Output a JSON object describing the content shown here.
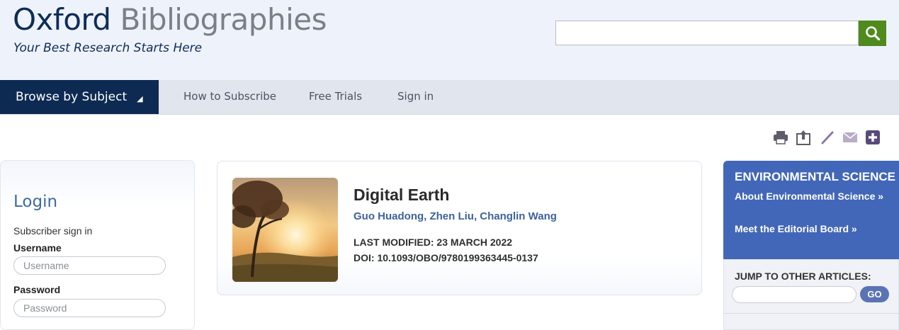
{
  "brand": {
    "name_primary": "Oxford",
    "name_secondary": "Bibliographies",
    "tagline": "Your Best Research Starts Here"
  },
  "search": {
    "value": "",
    "button_icon": "search-icon",
    "button_color": "#4f8a1d"
  },
  "nav": {
    "browse_label": "Browse by Subject",
    "browse_icon": "triangle-up-icon",
    "links": [
      "How to Subscribe",
      "Free Trials",
      "Sign in"
    ]
  },
  "toolbar": {
    "icons": [
      "print-icon",
      "share-icon",
      "edit-icon",
      "email-icon",
      "add-icon"
    ]
  },
  "login": {
    "title": "Login",
    "subtitle": "Subscriber sign in",
    "username_label": "Username",
    "username_placeholder": "Username",
    "password_label": "Password",
    "password_placeholder": "Password"
  },
  "article": {
    "title": "Digital Earth",
    "authors": "Guo Huadong, Zhen Liu, Changlin Wang",
    "last_modified": "LAST MODIFIED: 23 MARCH 2022",
    "doi": "DOI: 10.1093/OBO/9780199363445-0137"
  },
  "subject_panel": {
    "title": "ENVIRONMENTAL SCIENCE",
    "about_link": "About Environmental Science »",
    "board_link": "Meet the Editorial Board »",
    "color": "#4267b8"
  },
  "jump": {
    "title": "JUMP TO OTHER ARTICLES:",
    "go_label": "GO"
  }
}
